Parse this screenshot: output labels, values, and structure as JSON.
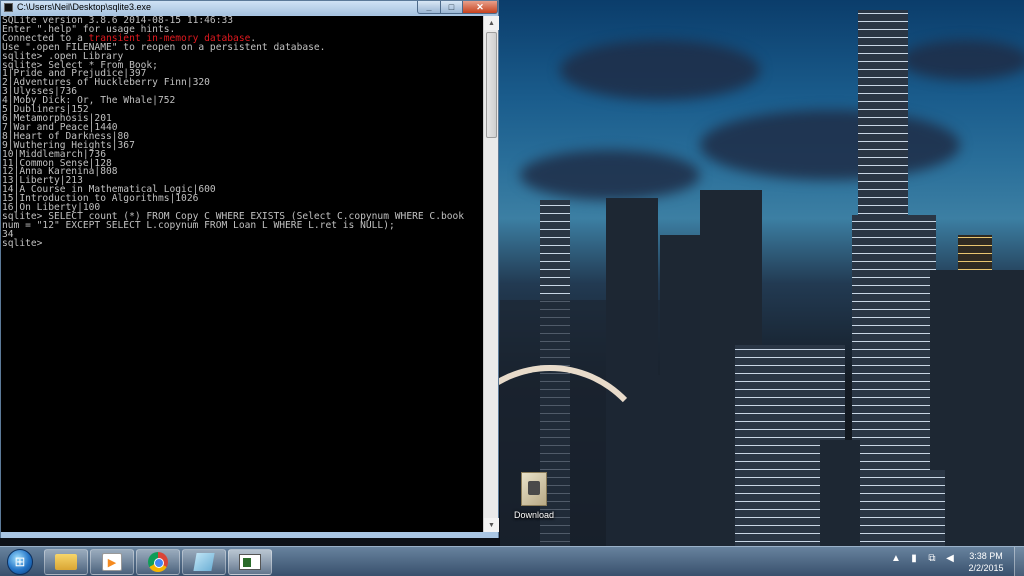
{
  "window": {
    "title": "C:\\Users\\Neil\\Desktop\\sqlite3.exe",
    "minimize_glyph": "_",
    "maximize_glyph": "□",
    "close_glyph": "✕"
  },
  "console": {
    "lines_before": [
      "SQLite version 3.8.6 2014-08-15 11:46:33",
      "Enter \".help\" for usage hints."
    ],
    "connected_prefix": "Connected to a ",
    "connected_highlight": "transient in-memory database",
    "connected_suffix": ".",
    "lines_after": [
      "Use \".open FILENAME\" to reopen on a persistent database.",
      "sqlite> .open Library",
      "sqlite> Select * From Book;",
      "1|Pride and Prejudice|397",
      "2|Adventures of Huckleberry Finn|320",
      "3|Ulysses|736",
      "4|Moby Dick: Or, The Whale|752",
      "5|Dubliners|152",
      "6|Metamorphosis|201",
      "7|War and Peace|1440",
      "8|Heart of Darkness|80",
      "9|Wuthering Heights|367",
      "10|Middlemarch|736",
      "11|Common Sense|128",
      "12|Anna Karenina|808",
      "13|Liberty|213",
      "14|A Course in Mathematical Logic|600",
      "15|Introduction to Algorithms|1026",
      "16|On Liberty|100",
      "sqlite> SELECT count (*) FROM Copy C WHERE EXISTS (Select C.copynum WHERE C.book",
      "num = \"12\" EXCEPT SELECT L.copynum FROM Loan L WHERE L.ret is NULL);",
      "34",
      "sqlite>"
    ]
  },
  "desktop": {
    "icon_label": "Download"
  },
  "taskbar": {
    "start_glyph": "⊞",
    "media_glyph": "▶",
    "tray_icons": [
      "▲",
      "▮",
      "⧉",
      "◀"
    ],
    "time": "3:38 PM",
    "date": "2/2/2015"
  }
}
